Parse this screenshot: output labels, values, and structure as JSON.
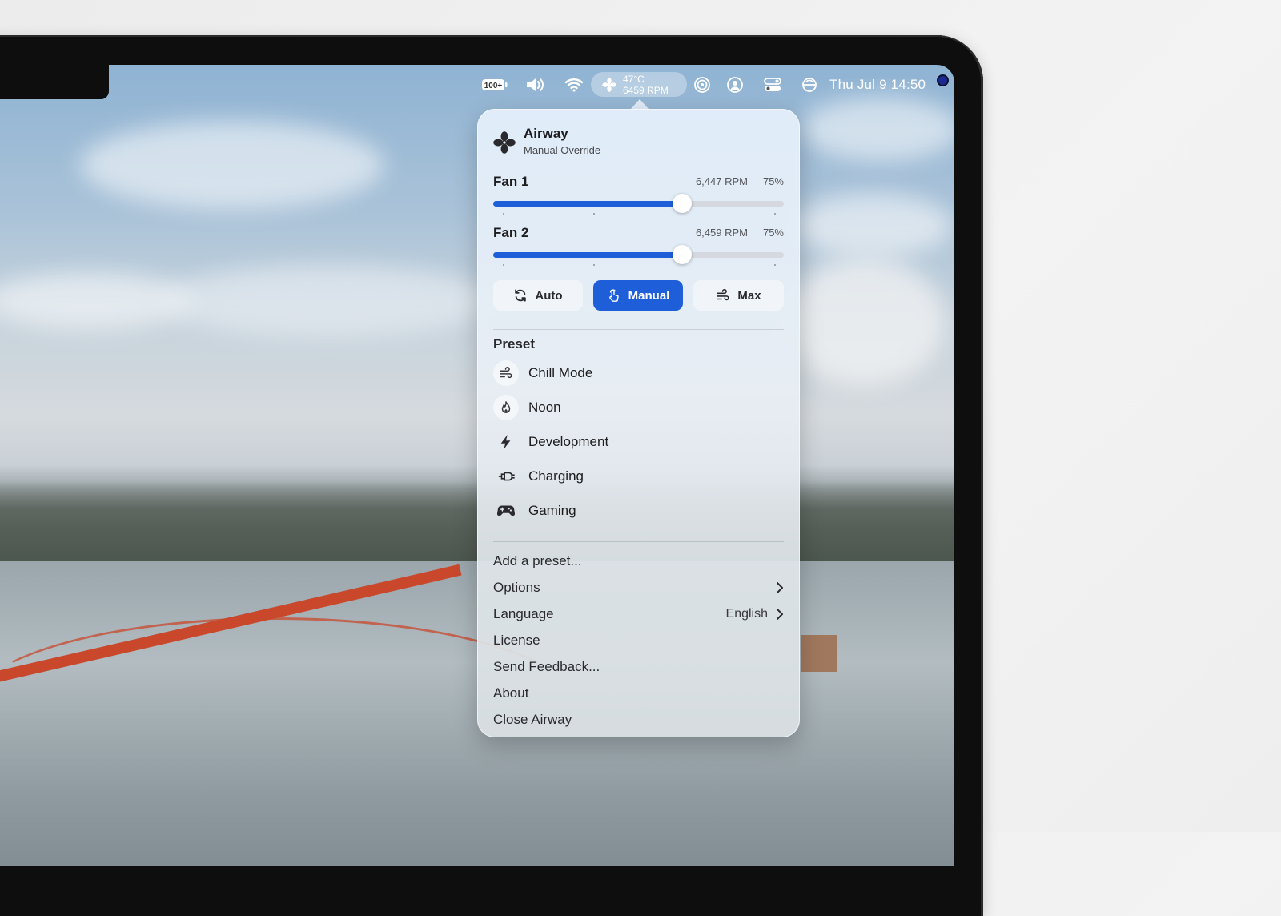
{
  "menubar": {
    "battery": "100+",
    "fan_status": {
      "temperature": "47°C",
      "rpm": "6459 RPM"
    },
    "clock": "Thu Jul 9  14:50"
  },
  "popover": {
    "app_name": "Airway",
    "mode_subtitle": "Manual Override",
    "fans": [
      {
        "label": "Fan 1",
        "rpm": "6,447 RPM",
        "percent": "75%",
        "level": 0.65
      },
      {
        "label": "Fan 2",
        "rpm": "6,459 RPM",
        "percent": "75%",
        "level": 0.65
      }
    ],
    "modes": [
      {
        "label": "Auto",
        "icon": "refresh-icon",
        "active": false
      },
      {
        "label": "Manual",
        "icon": "hand-pointer-icon",
        "active": true
      },
      {
        "label": "Max",
        "icon": "wind-icon",
        "active": false
      }
    ],
    "preset_heading": "Preset",
    "presets": [
      {
        "label": "Chill Mode",
        "icon": "wind-icon"
      },
      {
        "label": "Noon",
        "icon": "flame-icon"
      },
      {
        "label": "Development",
        "icon": "bolt-icon"
      },
      {
        "label": "Charging",
        "icon": "plug-icon"
      },
      {
        "label": "Gaming",
        "icon": "gamepad-icon"
      }
    ],
    "menu": {
      "add_preset": "Add a preset...",
      "options": "Options",
      "language": "Language",
      "language_value": "English",
      "license": "License",
      "send_feedback": "Send Feedback...",
      "about": "About",
      "close": "Close Airway"
    }
  },
  "colors": {
    "accent": "#1e5fd9"
  }
}
